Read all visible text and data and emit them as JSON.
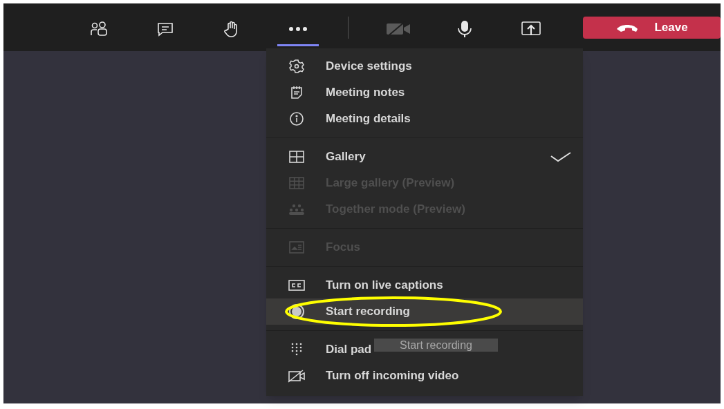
{
  "toolbar": {
    "groups": [
      {
        "buttons": [
          {
            "kind": "people",
            "selected": false
          },
          {
            "kind": "chat",
            "selected": false
          },
          {
            "kind": "hand",
            "selected": false
          },
          {
            "kind": "more",
            "selected": true
          }
        ]
      },
      {
        "buttons": [
          {
            "kind": "camera-off",
            "selected": false
          },
          {
            "kind": "mic",
            "selected": false
          },
          {
            "kind": "share",
            "selected": false
          }
        ]
      }
    ],
    "leave_button": {
      "label": "Leave"
    }
  },
  "menu": {
    "sections": [
      {
        "items": [
          {
            "kind": "gear",
            "label": "Device settings",
            "disabled": false,
            "checked": false,
            "hovered": false,
            "circled": false
          },
          {
            "kind": "notes",
            "label": "Meeting notes",
            "disabled": false,
            "checked": false,
            "hovered": false,
            "circled": false
          },
          {
            "kind": "info",
            "label": "Meeting details",
            "disabled": false,
            "checked": false,
            "hovered": false,
            "circled": false
          }
        ]
      },
      {
        "items": [
          {
            "kind": "grid4",
            "label": "Gallery",
            "disabled": false,
            "checked": true,
            "hovered": false,
            "circled": false
          },
          {
            "kind": "grid9",
            "label": "Large gallery (Preview)",
            "disabled": true,
            "checked": false,
            "hovered": false,
            "circled": false
          },
          {
            "kind": "group",
            "label": "Together mode (Preview)",
            "disabled": true,
            "checked": false,
            "hovered": false,
            "circled": false
          }
        ]
      },
      {
        "items": [
          {
            "kind": "focus",
            "label": "Focus",
            "disabled": true,
            "checked": false,
            "hovered": false,
            "circled": false
          }
        ]
      },
      {
        "items": [
          {
            "kind": "cc",
            "label": "Turn on live captions",
            "disabled": false,
            "checked": false,
            "hovered": false,
            "circled": false
          },
          {
            "kind": "record",
            "label": "Start recording",
            "disabled": false,
            "checked": false,
            "hovered": true,
            "circled": true
          }
        ]
      },
      {
        "items": [
          {
            "kind": "dialpad",
            "label": "Dial pad",
            "disabled": false,
            "checked": false,
            "hovered": false,
            "circled": false
          },
          {
            "kind": "video-off",
            "label": "Turn off incoming video",
            "disabled": false,
            "checked": false,
            "hovered": false,
            "circled": false
          }
        ]
      }
    ],
    "tooltip": "Start recording"
  }
}
